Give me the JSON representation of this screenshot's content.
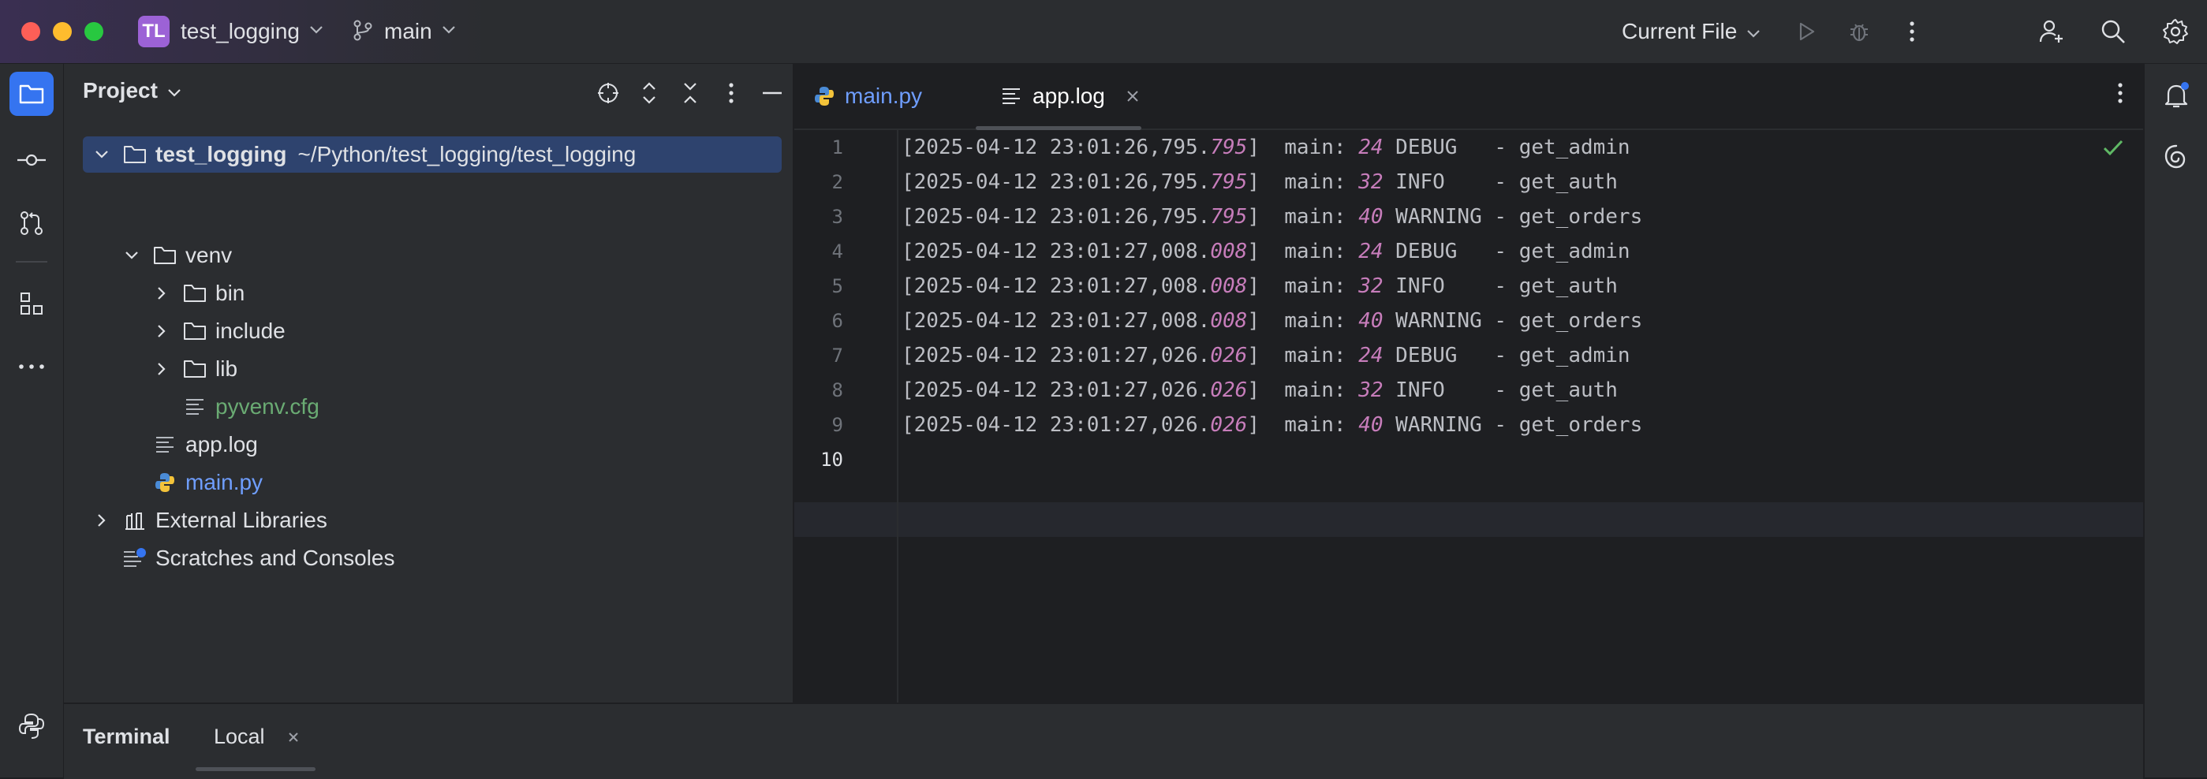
{
  "titlebar": {
    "project_badge": "TL",
    "project_name": "test_logging",
    "branch": "main",
    "run_config": "Current File"
  },
  "project_panel": {
    "title": "Project",
    "tree": [
      {
        "label": "test_logging",
        "hint": "~/Python/test_logging/test_logging",
        "type": "folder",
        "expanded": true,
        "selected": true
      },
      {
        "label": "venv",
        "type": "folder",
        "expanded": true
      },
      {
        "label": "bin",
        "type": "folder",
        "expanded": false
      },
      {
        "label": "include",
        "type": "folder",
        "expanded": false
      },
      {
        "label": "lib",
        "type": "folder",
        "expanded": false
      },
      {
        "label": "pyvenv.cfg",
        "type": "file-text",
        "color": "#6aab73"
      },
      {
        "label": "app.log",
        "type": "file-text"
      },
      {
        "label": "main.py",
        "type": "file-python",
        "color": "#6f9eff"
      },
      {
        "label": "External Libraries",
        "type": "libraries",
        "expanded": false
      },
      {
        "label": "Scratches and Consoles",
        "type": "scratches"
      }
    ]
  },
  "editor": {
    "tabs": [
      {
        "label": "main.py",
        "active": false,
        "color": "#6f9eff"
      },
      {
        "label": "app.log",
        "active": true
      }
    ],
    "lines": [
      {
        "num": "1",
        "ts": "[2025-04-12 23:01:26,795.",
        "ms": "795",
        "mid": "]  main: ",
        "lineno": "24",
        "rest": " DEBUG   - get_admin"
      },
      {
        "num": "2",
        "ts": "[2025-04-12 23:01:26,795.",
        "ms": "795",
        "mid": "]  main: ",
        "lineno": "32",
        "rest": " INFO    - get_auth"
      },
      {
        "num": "3",
        "ts": "[2025-04-12 23:01:26,795.",
        "ms": "795",
        "mid": "]  main: ",
        "lineno": "40",
        "rest": " WARNING - get_orders"
      },
      {
        "num": "4",
        "ts": "[2025-04-12 23:01:27,008.",
        "ms": "008",
        "mid": "]  main: ",
        "lineno": "24",
        "rest": " DEBUG   - get_admin"
      },
      {
        "num": "5",
        "ts": "[2025-04-12 23:01:27,008.",
        "ms": "008",
        "mid": "]  main: ",
        "lineno": "32",
        "rest": " INFO    - get_auth"
      },
      {
        "num": "6",
        "ts": "[2025-04-12 23:01:27,008.",
        "ms": "008",
        "mid": "]  main: ",
        "lineno": "40",
        "rest": " WARNING - get_orders"
      },
      {
        "num": "7",
        "ts": "[2025-04-12 23:01:27,026.",
        "ms": "026",
        "mid": "]  main: ",
        "lineno": "24",
        "rest": " DEBUG   - get_admin"
      },
      {
        "num": "8",
        "ts": "[2025-04-12 23:01:27,026.",
        "ms": "026",
        "mid": "]  main: ",
        "lineno": "32",
        "rest": " INFO    - get_auth"
      },
      {
        "num": "9",
        "ts": "[2025-04-12 23:01:27,026.",
        "ms": "026",
        "mid": "]  main: ",
        "lineno": "40",
        "rest": " WARNING - get_orders"
      },
      {
        "num": "10",
        "ts": "",
        "ms": "",
        "mid": "",
        "lineno": "",
        "rest": ""
      }
    ]
  },
  "terminal": {
    "title": "Terminal",
    "tab": "Local"
  },
  "colors": {
    "accent": "#3574f0",
    "selection": "#2e436e",
    "python_file": "#6f9eff",
    "cfg_file": "#6aab73",
    "italic_numbers": "#c77dbb"
  }
}
